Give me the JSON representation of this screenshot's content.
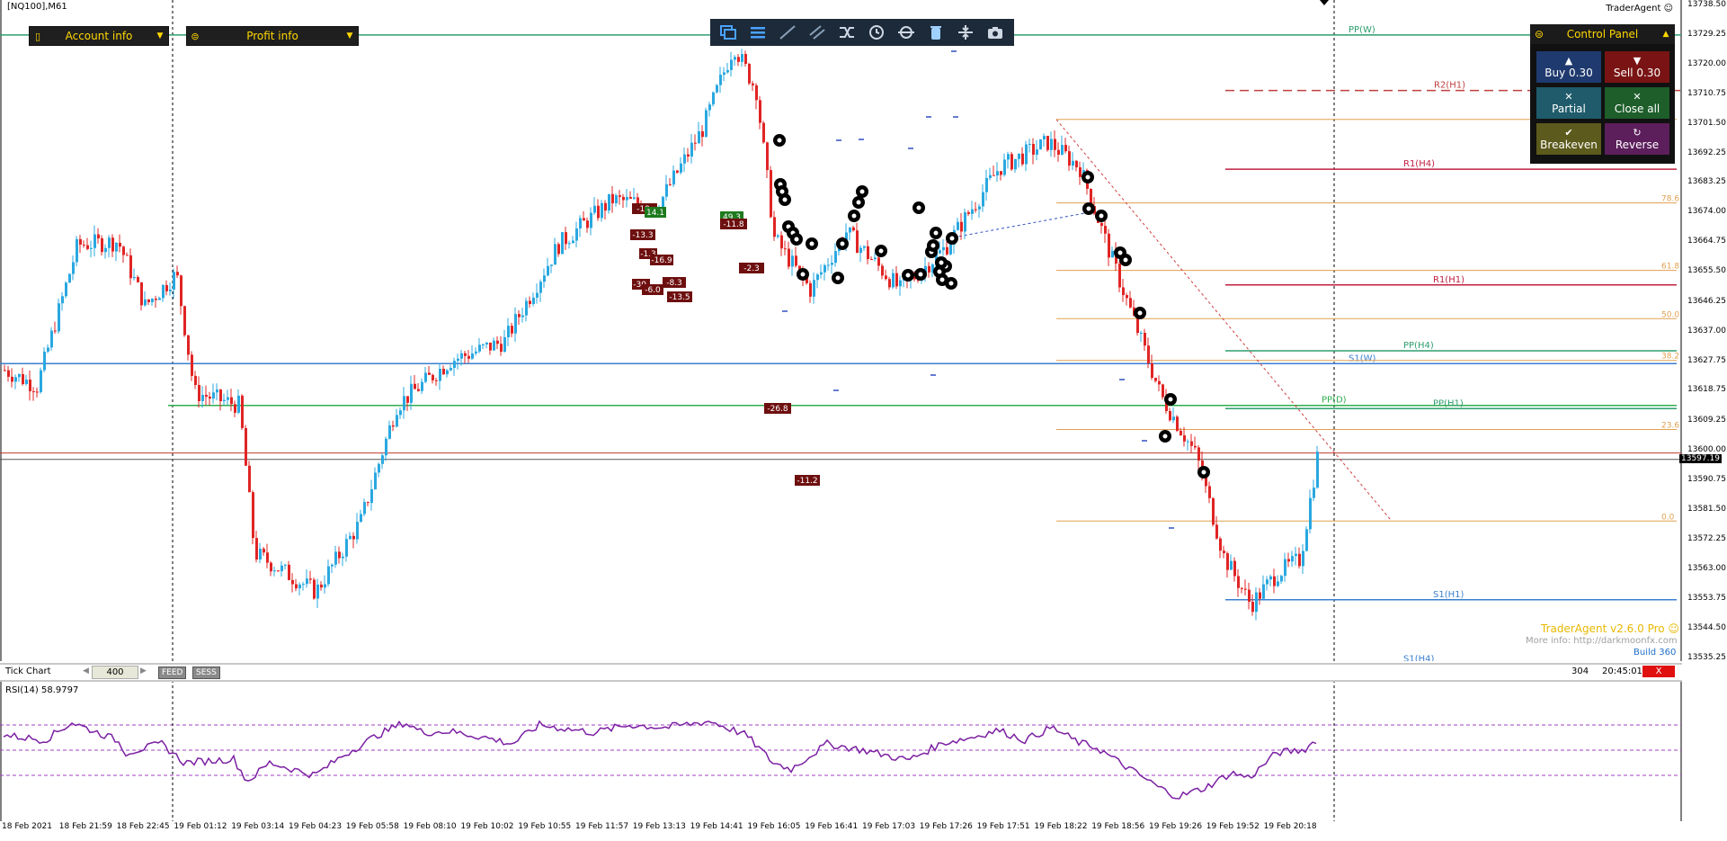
{
  "header": {
    "symbol": "[NQ100],M61",
    "brand": "TraderAgent ☺"
  },
  "account_dropdown": {
    "label": "Account info"
  },
  "profit_dropdown": {
    "label": "Profit info"
  },
  "toolbar": {
    "icons": [
      "windows-icon",
      "menu-icon",
      "trendline-icon",
      "channel-icon",
      "shuffle-icon",
      "clock-icon",
      "target-icon",
      "trash-icon",
      "split-icon",
      "camera-icon"
    ]
  },
  "control_panel": {
    "title": "Control Panel",
    "buy": {
      "label": "Buy 0.30",
      "color": "#1f3a6e"
    },
    "sell": {
      "label": "Sell 0.30",
      "color": "#7a1414"
    },
    "partial": {
      "label": "Partial",
      "color": "#1f5b6b"
    },
    "close_all": {
      "label": "Close all",
      "color": "#1d5e2a"
    },
    "breakeven": {
      "label": "Breakeven",
      "color": "#5c5a1c"
    },
    "reverse": {
      "label": "Reverse",
      "color": "#5c1f5c"
    }
  },
  "price_axis": {
    "labels": [
      "13738.50",
      "13729.25",
      "13720.00",
      "13710.75",
      "13701.50",
      "13692.25",
      "13683.25",
      "13674.00",
      "13664.75",
      "13655.50",
      "13646.25",
      "13637.00",
      "13627.75",
      "13618.75",
      "13609.25",
      "13600.00",
      "13590.75",
      "13581.50",
      "13572.25",
      "13563.00",
      "13553.75",
      "13544.50",
      "13535.25"
    ],
    "current_price": "13597.19"
  },
  "levels": [
    {
      "name": "PP(W)",
      "price": 13729.3,
      "color": "#2e9e6e"
    },
    {
      "name": "R2(H1)",
      "price": 13712.0,
      "color": "#c04040"
    },
    {
      "name": "R1(H4)",
      "price": 13687.5,
      "color": "#c02040"
    },
    {
      "name": "R1(H1)",
      "price": 13651.5,
      "color": "#c02040"
    },
    {
      "name": "PP(H4)",
      "price": 13631.0,
      "color": "#2e9e6e"
    },
    {
      "name": "S1(W)",
      "price": 13627.0,
      "color": "#3a7fd0"
    },
    {
      "name": "PP(D)",
      "price": 13614.0,
      "color": "#2eae4e"
    },
    {
      "name": "PP(H1)",
      "price": 13613.0,
      "color": "#2e9e6e"
    },
    {
      "name": "S1(H1)",
      "price": 13553.5,
      "color": "#3a7fd0"
    },
    {
      "name": "S1(H4)",
      "price": 13533.5,
      "color": "#3a7fd0"
    }
  ],
  "fib_levels": [
    "78.6",
    "61.8",
    "50.0",
    "38.2",
    "23.6",
    "0.0"
  ],
  "trade_labels": [
    {
      "text": "-19.",
      "bg": "#6e0f0f"
    },
    {
      "text": "14.1",
      "bg": "#1d7a1d"
    },
    {
      "text": "-13.3",
      "bg": "#6e0f0f"
    },
    {
      "text": "-1.3",
      "bg": "#6e0f0f"
    },
    {
      "text": "-16.9",
      "bg": "#6e0f0f"
    },
    {
      "text": "-30.",
      "bg": "#6e0f0f"
    },
    {
      "text": "-8.3",
      "bg": "#6e0f0f"
    },
    {
      "text": "-6.0",
      "bg": "#6e0f0f"
    },
    {
      "text": "-13.5",
      "bg": "#6e0f0f"
    },
    {
      "text": "49.3",
      "bg": "#1d7a1d"
    },
    {
      "text": "-11.8",
      "bg": "#6e0f0f"
    },
    {
      "text": "-2.3",
      "bg": "#6e0f0f"
    },
    {
      "text": "-26.8",
      "bg": "#6e0f0f"
    },
    {
      "text": "-11.2",
      "bg": "#6e0f0f"
    }
  ],
  "statusbar": {
    "mode": "Tick Chart",
    "ticks": "400",
    "feed": "FEED",
    "sess": "SESS",
    "count": "304",
    "time": "20:45:01",
    "close": "X"
  },
  "rsi": {
    "label": "RSI(14) 58.9797",
    "levels": [
      "100",
      "70",
      "50",
      "30",
      "0"
    ]
  },
  "x_axis": [
    "18 Feb 2021",
    "18 Feb 21:59",
    "18 Feb 22:45",
    "19 Feb 01:12",
    "19 Feb 03:14",
    "19 Feb 04:23",
    "19 Feb 05:58",
    "19 Feb 08:10",
    "19 Feb 10:02",
    "19 Feb 10:55",
    "19 Feb 11:57",
    "19 Feb 13:13",
    "19 Feb 14:41",
    "19 Feb 16:05",
    "19 Feb 16:41",
    "19 Feb 17:03",
    "19 Feb 17:26",
    "19 Feb 17:51",
    "19 Feb 18:22",
    "19 Feb 18:56",
    "19 Feb 19:26",
    "19 Feb 19:52",
    "19 Feb 20:18"
  ],
  "watermark": {
    "title": "TraderAgent v2.6.0 Pro ☺",
    "info": "More info: http://darkmoonfx.com",
    "build": "Build 360"
  }
}
